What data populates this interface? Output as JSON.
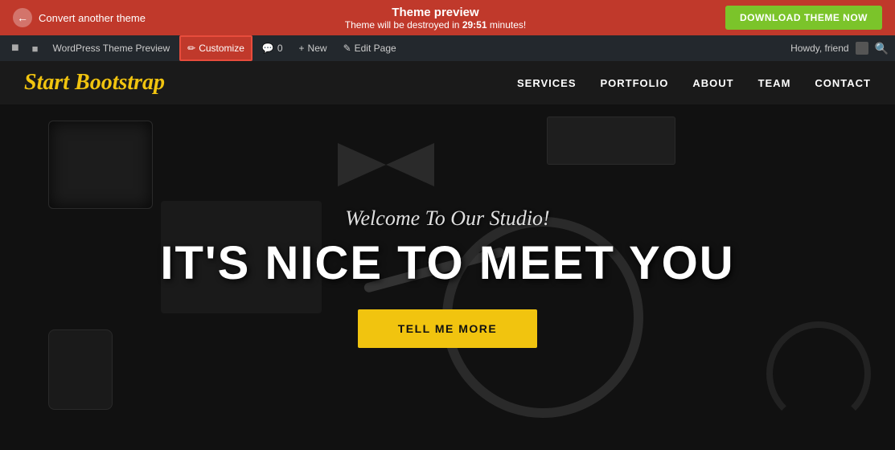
{
  "banner": {
    "back_label": "Convert another theme",
    "title": "Theme preview",
    "subtitle_pre": "Theme will be destroyed in ",
    "countdown": "29:51",
    "subtitle_post": " minutes!",
    "download_btn": "DOWNLOAD THEME NOW"
  },
  "admin_bar": {
    "wp_label": "🅦",
    "theme_preview": "WordPress Theme Preview",
    "customize": "Customize",
    "comments": "0",
    "new": "New",
    "edit_page": "Edit Page",
    "howdy": "Howdy, friend",
    "search_label": "🔍"
  },
  "nav": {
    "logo": "Start Bootstrap",
    "links": [
      {
        "label": "SERVICES"
      },
      {
        "label": "PORTFOLIO"
      },
      {
        "label": "ABOUT"
      },
      {
        "label": "TEAM"
      },
      {
        "label": "CONTACT"
      }
    ]
  },
  "hero": {
    "subtitle": "Welcome To Our Studio!",
    "title": "IT'S NICE TO MEET YOU",
    "cta_btn": "TELL ME MORE"
  }
}
